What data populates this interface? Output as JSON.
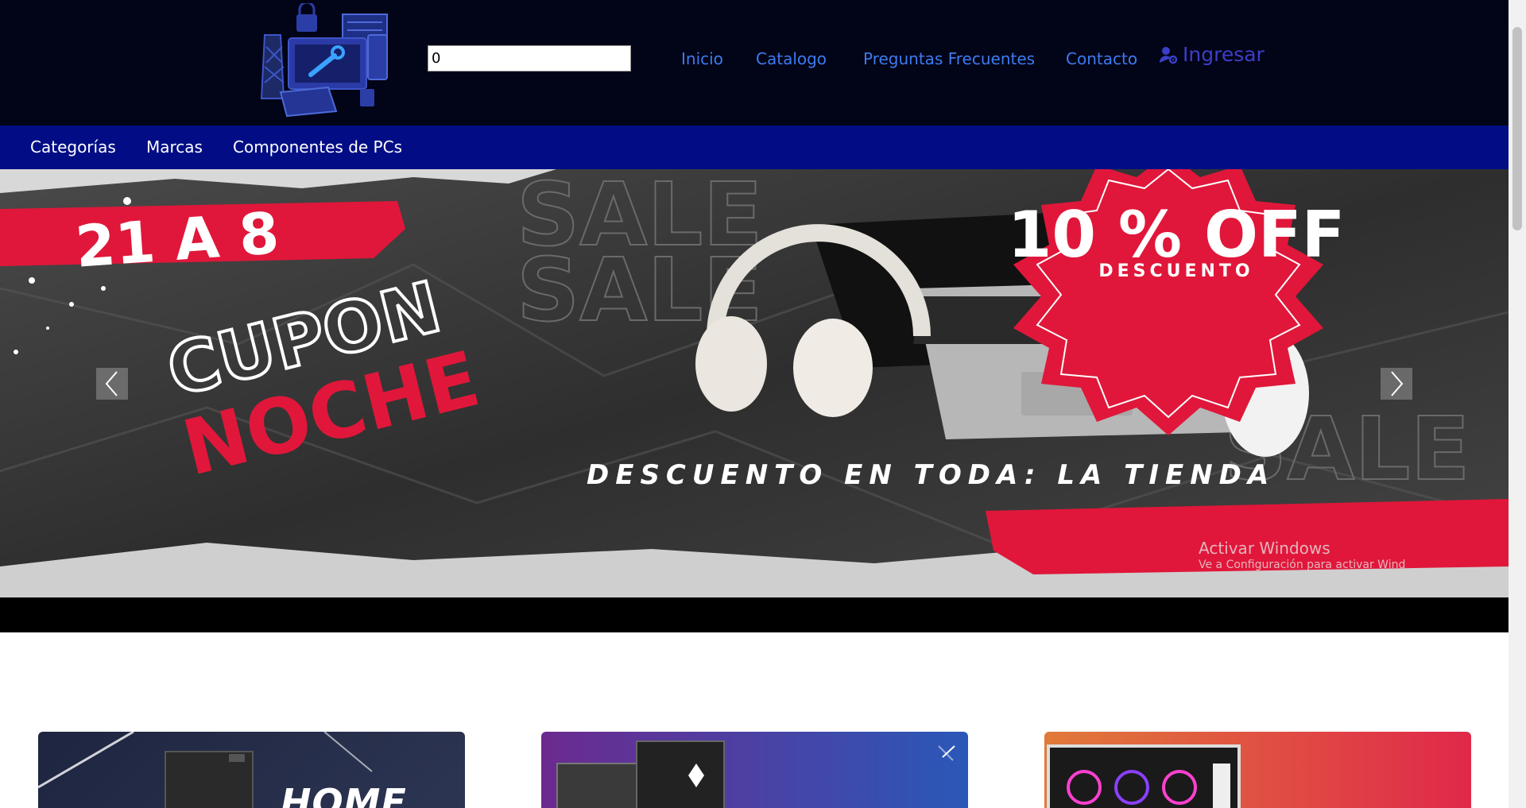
{
  "header": {
    "search_value": "0",
    "nav": [
      "Inicio",
      "Catalogo",
      "Preguntas Frecuentes",
      "Contacto"
    ],
    "login_label": "Ingresar",
    "logo_icon": "computer-repair-logo"
  },
  "subnav": [
    "Categorías",
    "Marcas",
    "Componentes de PCs"
  ],
  "banner": {
    "date_text": "21 A 8",
    "cupon_text": "CUPON",
    "noche_text": "NOCHE",
    "offer_text": "10 % OFF",
    "offer_sub": "DESCUENTO",
    "tagline": "DESCUENTO EN TODA: LA TIENDA",
    "bg_word": "SALE",
    "watermark_title": "Activar Windows",
    "watermark_sub": "Ve a Configuración para activar Wind",
    "accent": "#e0173a"
  },
  "cards": [
    {
      "label": "HOME"
    },
    {
      "label": ""
    },
    {
      "label": ""
    }
  ]
}
